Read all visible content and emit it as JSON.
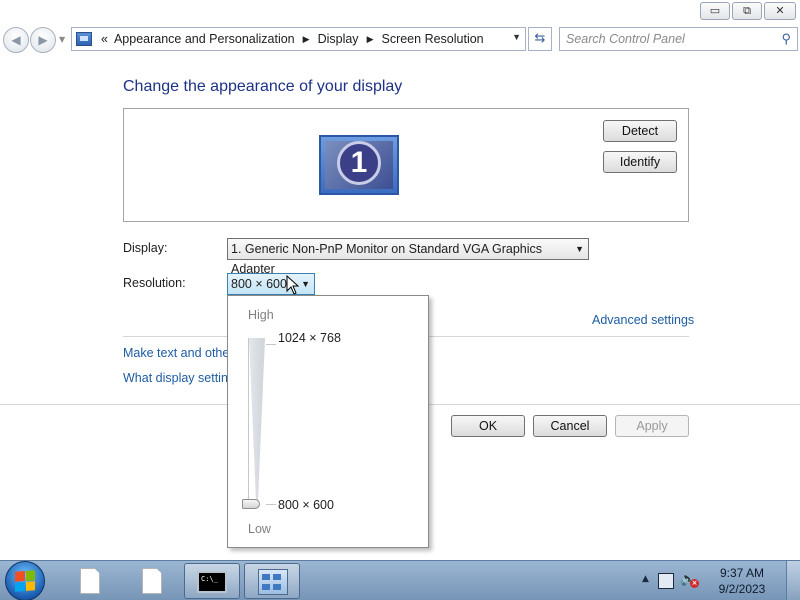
{
  "window": {
    "minimize_label": "▭",
    "maximize_label": "⧉",
    "close_label": "✕"
  },
  "nav": {
    "back_label": "◀",
    "forward_label": "▶",
    "address": {
      "chevron": "«",
      "crumbs": [
        "Appearance and Personalization",
        "Display",
        "Screen Resolution"
      ]
    },
    "refresh_label": "⇆",
    "search_placeholder": "Search Control Panel"
  },
  "content": {
    "heading": "Change the appearance of your display",
    "monitor_number": "1",
    "detect_label": "Detect",
    "identify_label": "Identify",
    "display_label": "Display:",
    "display_value": "1. Generic Non-PnP Monitor on Standard VGA Graphics Adapter",
    "resolution_label": "Resolution:",
    "resolution_value": "800 × 600",
    "advanced_link": "Advanced settings",
    "link_text_size": "Make text and other",
    "link_display_settings": "What display setting",
    "ok_label": "OK",
    "cancel_label": "Cancel",
    "apply_label": "Apply"
  },
  "resolution_popup": {
    "high_label": "High",
    "low_label": "Low",
    "max_value": "1024 × 768",
    "min_value": "800 × 600",
    "slider_level": 0.0
  },
  "taskbar": {
    "time": "9:37 AM",
    "date": "9/2/2023",
    "cmd_text": "C:\\_"
  },
  "colors": {
    "heading": "#1e3287",
    "link": "#1e5ca3",
    "taskbar": "#8aa7c6"
  }
}
